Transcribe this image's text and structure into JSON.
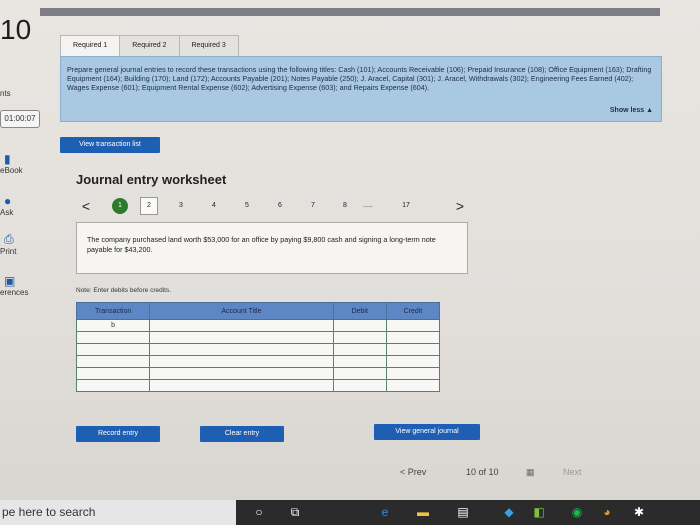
{
  "question_number": "10",
  "sidebar": {
    "points_label": "nts",
    "timer": "01:00:07",
    "items": [
      {
        "label": "eBook",
        "icon": "book-icon"
      },
      {
        "label": "Ask",
        "icon": "question-icon"
      },
      {
        "label": "Print",
        "icon": "print-icon"
      },
      {
        "label": "erences",
        "icon": "references-icon"
      }
    ]
  },
  "tabs": [
    "Required 1",
    "Required 2",
    "Required 3"
  ],
  "instructions": {
    "text": "Prepare general journal entries to record these transactions using the following titles: Cash (101); Accounts Receivable (106); Prepaid Insurance (108); Office Equipment (163); Drafting Equipment (164); Building (170); Land (172); Accounts Payable (201); Notes Payable (250); J. Aracel, Capital (301); J. Aracel, Withdrawals (302); Engineering Fees Earned (402); Wages Expense (601); Equipment Rental Expense (602); Advertising Expense (603); and Repairs Expense (604).",
    "show_less": "Show less ▲"
  },
  "view_transaction_list": "View transaction list",
  "worksheet": {
    "title": "Journal entry worksheet",
    "pager": {
      "prev": "<",
      "next": ">",
      "current": "1",
      "pages": [
        "2",
        "3",
        "4",
        "5",
        "6",
        "7",
        "8",
        "17"
      ],
      "ellipsis": "....."
    },
    "transaction_text": "The company purchased land worth $53,000 for an office by paying $9,800 cash and signing a long-term note payable for $43,200.",
    "note": "Note: Enter debits before credits.",
    "table": {
      "headers": [
        "Transaction",
        "Account Title",
        "Debit",
        "Credit"
      ],
      "rows": [
        [
          "b",
          "",
          "",
          ""
        ],
        [
          "",
          "",
          "",
          ""
        ],
        [
          "",
          "",
          "",
          ""
        ],
        [
          "",
          "",
          "",
          ""
        ],
        [
          "",
          "",
          "",
          ""
        ],
        [
          "",
          "",
          "",
          ""
        ]
      ]
    },
    "buttons": {
      "record": "Record entry",
      "clear": "Clear entry",
      "view_journal": "View general journal"
    }
  },
  "pagination": {
    "prev": "< Prev",
    "status": "10 of 10",
    "next": "Next"
  },
  "taskbar": {
    "search_text": "pe here to search"
  }
}
